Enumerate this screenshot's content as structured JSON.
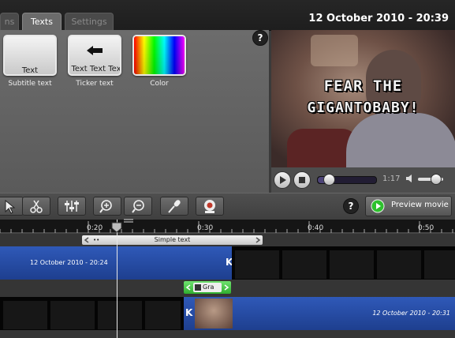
{
  "tabs": [
    {
      "label": "ns"
    },
    {
      "label": "Texts"
    },
    {
      "label": "Settings"
    }
  ],
  "header": {
    "datetime": "12 October 2010 - 20:39"
  },
  "text_styles": [
    {
      "thumb_text": "Text",
      "label": "Subtitle text"
    },
    {
      "thumb_text": "Text Text Tex",
      "label": "Ticker text"
    },
    {
      "thumb_text": "",
      "label": "Color"
    }
  ],
  "help": {
    "symbol": "?"
  },
  "preview": {
    "overlay_line1": "FEAR THE",
    "overlay_line2": "GIGANTOBABY!"
  },
  "player": {
    "time": "1:17",
    "progress": 0.18,
    "volume": 0.7,
    "volume_icon": "speaker-icon"
  },
  "toolbar": {
    "tools": [
      "pointer-icon",
      "scissors-icon",
      "sliders-icon",
      "zoom-in-icon",
      "zoom-out-icon",
      "microphone-icon",
      "webcam-icon"
    ],
    "preview_label": "Preview movie"
  },
  "ruler": {
    "marks": [
      "0:20",
      "0:30",
      "0:40",
      "0:50"
    ]
  },
  "timeline": {
    "subtitle_label": "Simple text",
    "subtitle_handle": "••",
    "clip1_date": "12 October 2010 - 20:24",
    "clip2_date": "12 October 2010 - 20:31",
    "transition_label": "Gra"
  }
}
